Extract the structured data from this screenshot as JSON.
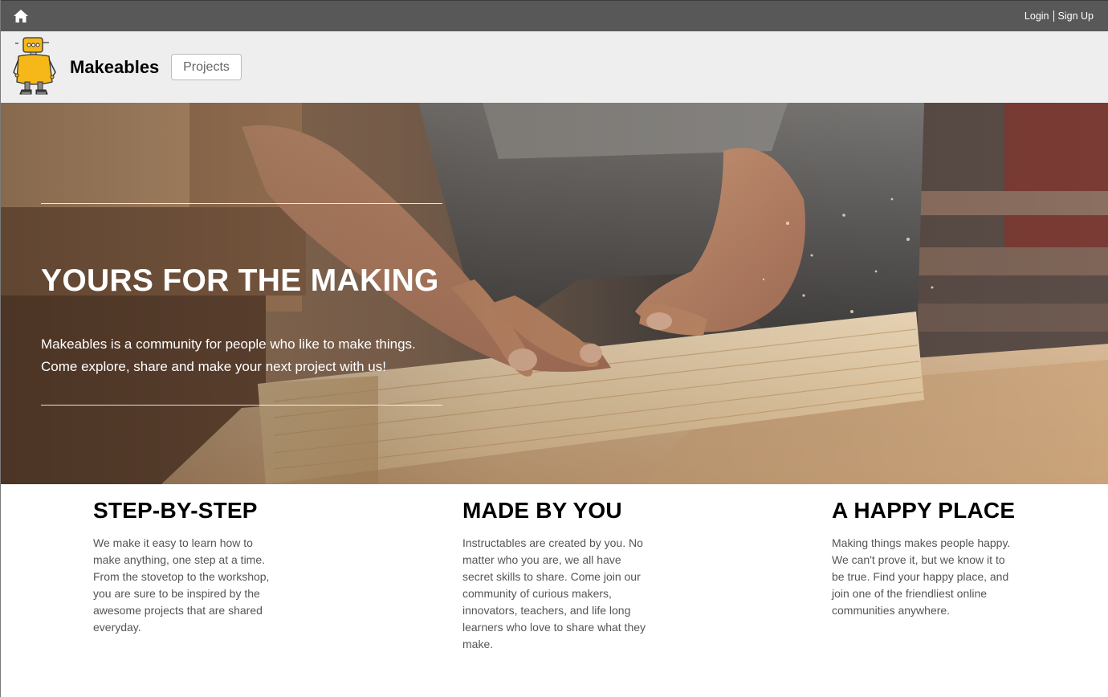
{
  "topbar": {
    "home_icon": "home-icon",
    "login_label": "Login",
    "signup_label": "Sign Up"
  },
  "header": {
    "logo_icon": "robot-logo-icon",
    "brand": "Makeables",
    "projects_label": "Projects"
  },
  "hero": {
    "title": "YOURS FOR THE MAKING",
    "text_line1": "Makeables is a community for people who like to make things.",
    "text_line2": "Come explore, share and make your next project with us!"
  },
  "features": [
    {
      "title": "STEP-BY-STEP",
      "body": "We make it easy to learn how to make anything, one step at a time. From the stovetop to the workshop, you are sure to be inspired by the awesome projects that are shared everyday."
    },
    {
      "title": "MADE BY YOU",
      "body": "Instructables are created by you. No matter who you are, we all have secret skills to share. Come join our community of curious makers, innovators, teachers, and life long learners who love to share what they make."
    },
    {
      "title": "A HAPPY PLACE",
      "body": "Making things makes people happy. We can't prove it, but we know it to be true. Find your happy place, and join one of the friendliest online communities anywhere."
    }
  ],
  "colors": {
    "topbar": "#585858",
    "header": "#eeeeee",
    "robot_yellow": "#f5b818"
  }
}
